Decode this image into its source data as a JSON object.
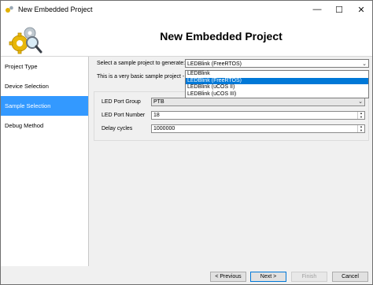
{
  "window": {
    "title": "New Embedded Project",
    "controls": {
      "minimize": "—",
      "maximize": "☐",
      "close": "✕"
    }
  },
  "header": {
    "heading": "New Embedded Project"
  },
  "sidebar": {
    "items": [
      {
        "label": "Project Type",
        "active": false
      },
      {
        "label": "Device Selection",
        "active": false
      },
      {
        "label": "Sample Selection",
        "active": true
      },
      {
        "label": "Debug Method",
        "active": false
      }
    ]
  },
  "sample": {
    "prompt": "Select a sample project to generate:",
    "selected": "LEDBlink (FreeRTOS)",
    "description": "This is a very basic sample project - ",
    "options": [
      "LEDBlink",
      "LEDBlink (FreeRTOS)",
      "LEDBlink (uCOS II)",
      "LEDBlink (uCOS III)"
    ],
    "highlighted_index": 1
  },
  "settings": {
    "led_port_group": {
      "label": "LED Port Group",
      "value": "PTB"
    },
    "led_port_number": {
      "label": "LED Port Number",
      "value": "18"
    },
    "delay_cycles": {
      "label": "Delay cycles",
      "value": "1000000"
    }
  },
  "footer": {
    "previous": "< Previous",
    "next": "Next >",
    "finish": "Finish",
    "cancel": "Cancel"
  },
  "colors": {
    "selection": "#3399ff",
    "dropdown_highlight": "#0078d7"
  }
}
